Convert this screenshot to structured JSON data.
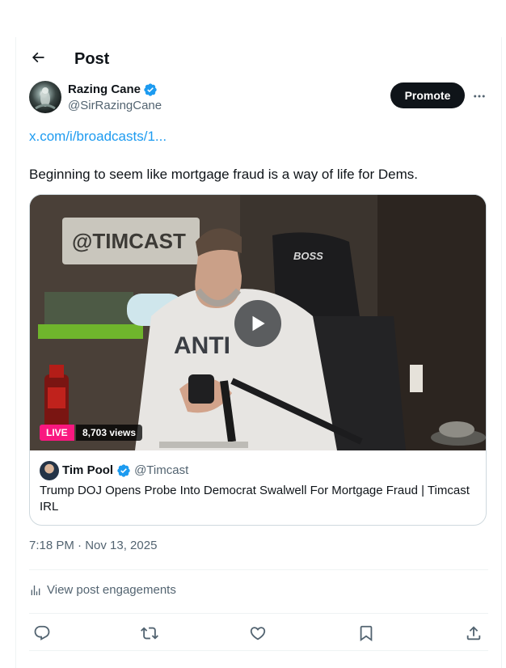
{
  "header": {
    "title": "Post"
  },
  "author": {
    "display_name": "Razing Cane",
    "handle": "@SirRazingCane",
    "verified": true
  },
  "buttons": {
    "promote": "Promote"
  },
  "post": {
    "link": "x.com/i/broadcasts/1...",
    "text": "Beginning to seem like mortgage fraud is a way of life for Dems.",
    "timestamp": "7:18 PM · Nov 13, 2025"
  },
  "card": {
    "live_label": "LIVE",
    "views": "8,703 views",
    "source_name": "Tim Pool",
    "source_handle": "@Timcast",
    "source_verified": true,
    "title": "Trump DOJ Opens Probe Into Democrat Swalwell For Mortgage Fraud | Timcast IRL",
    "video_sign_text": "@TIMCAST",
    "video_chair_text": "BOSS",
    "video_hoodie_text": "ANTI"
  },
  "engagements": {
    "label": "View post engagements"
  },
  "actions": [
    "reply-icon",
    "repost-icon",
    "like-icon",
    "bookmark-icon",
    "share-icon"
  ],
  "colors": {
    "accent": "#1d9bf0",
    "text": "#0f1419",
    "muted": "#536471",
    "live": "#f91880",
    "border": "#cfd9de"
  }
}
